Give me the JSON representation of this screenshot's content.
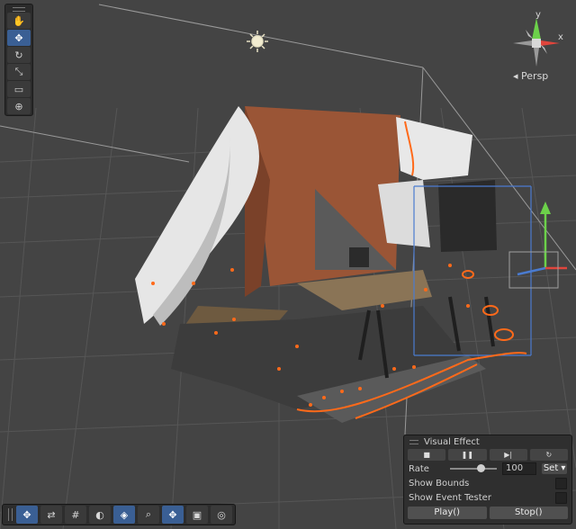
{
  "scene": {
    "camera_mode": "Persp",
    "gizmo_axes": {
      "y": "y",
      "x": "x"
    },
    "colors": {
      "background": "#444444",
      "grid": "#555555",
      "point_cloud_white": "#e6e6e6",
      "brick": "#9a5536",
      "floor": "#8a7456",
      "highlight": "#ff6a1a",
      "selection": "#4a7bd0",
      "gizmo_y": "#6cd14a",
      "gizmo_x": "#e0453c"
    }
  },
  "tool_palette": {
    "tools": [
      {
        "name": "hand-tool",
        "glyph": "✋",
        "active": false
      },
      {
        "name": "move-tool",
        "glyph": "✥",
        "active": true
      },
      {
        "name": "rotate-tool",
        "glyph": "↻",
        "active": false
      },
      {
        "name": "scale-tool",
        "glyph": "⤡",
        "active": false
      },
      {
        "name": "rect-tool",
        "glyph": "▭",
        "active": false
      },
      {
        "name": "transform-tool",
        "glyph": "⊕",
        "active": false
      }
    ]
  },
  "overlay_toolbar": {
    "buttons": [
      {
        "name": "move-handles",
        "glyph": "✥",
        "active": true
      },
      {
        "name": "pivot-toggle",
        "glyph": "⇄",
        "active": false
      },
      {
        "name": "grid-toggle",
        "glyph": "#",
        "active": false
      },
      {
        "name": "shading-mode",
        "glyph": "◐",
        "active": false
      },
      {
        "name": "layers-toggle",
        "glyph": "◈",
        "active": true
      },
      {
        "name": "search",
        "glyph": "⌕",
        "active": false
      },
      {
        "name": "gizmo-move",
        "glyph": "✥",
        "active": true
      },
      {
        "name": "camera",
        "glyph": "▣",
        "active": false
      },
      {
        "name": "compass",
        "glyph": "◎",
        "active": false
      }
    ]
  },
  "visual_effect_panel": {
    "title": "Visual Effect",
    "controls": [
      {
        "name": "stop",
        "glyph": "■"
      },
      {
        "name": "pause",
        "glyph": "❚❚"
      },
      {
        "name": "step",
        "glyph": "▶|"
      },
      {
        "name": "restart",
        "glyph": "↻"
      }
    ],
    "rate_label": "Rate",
    "rate_value": "100",
    "rate_slider_level": 0.62,
    "set_label": "Set ▾",
    "show_bounds_label": "Show Bounds",
    "show_event_tester_label": "Show Event Tester",
    "play_label": "Play()",
    "stop_label": "Stop()"
  }
}
